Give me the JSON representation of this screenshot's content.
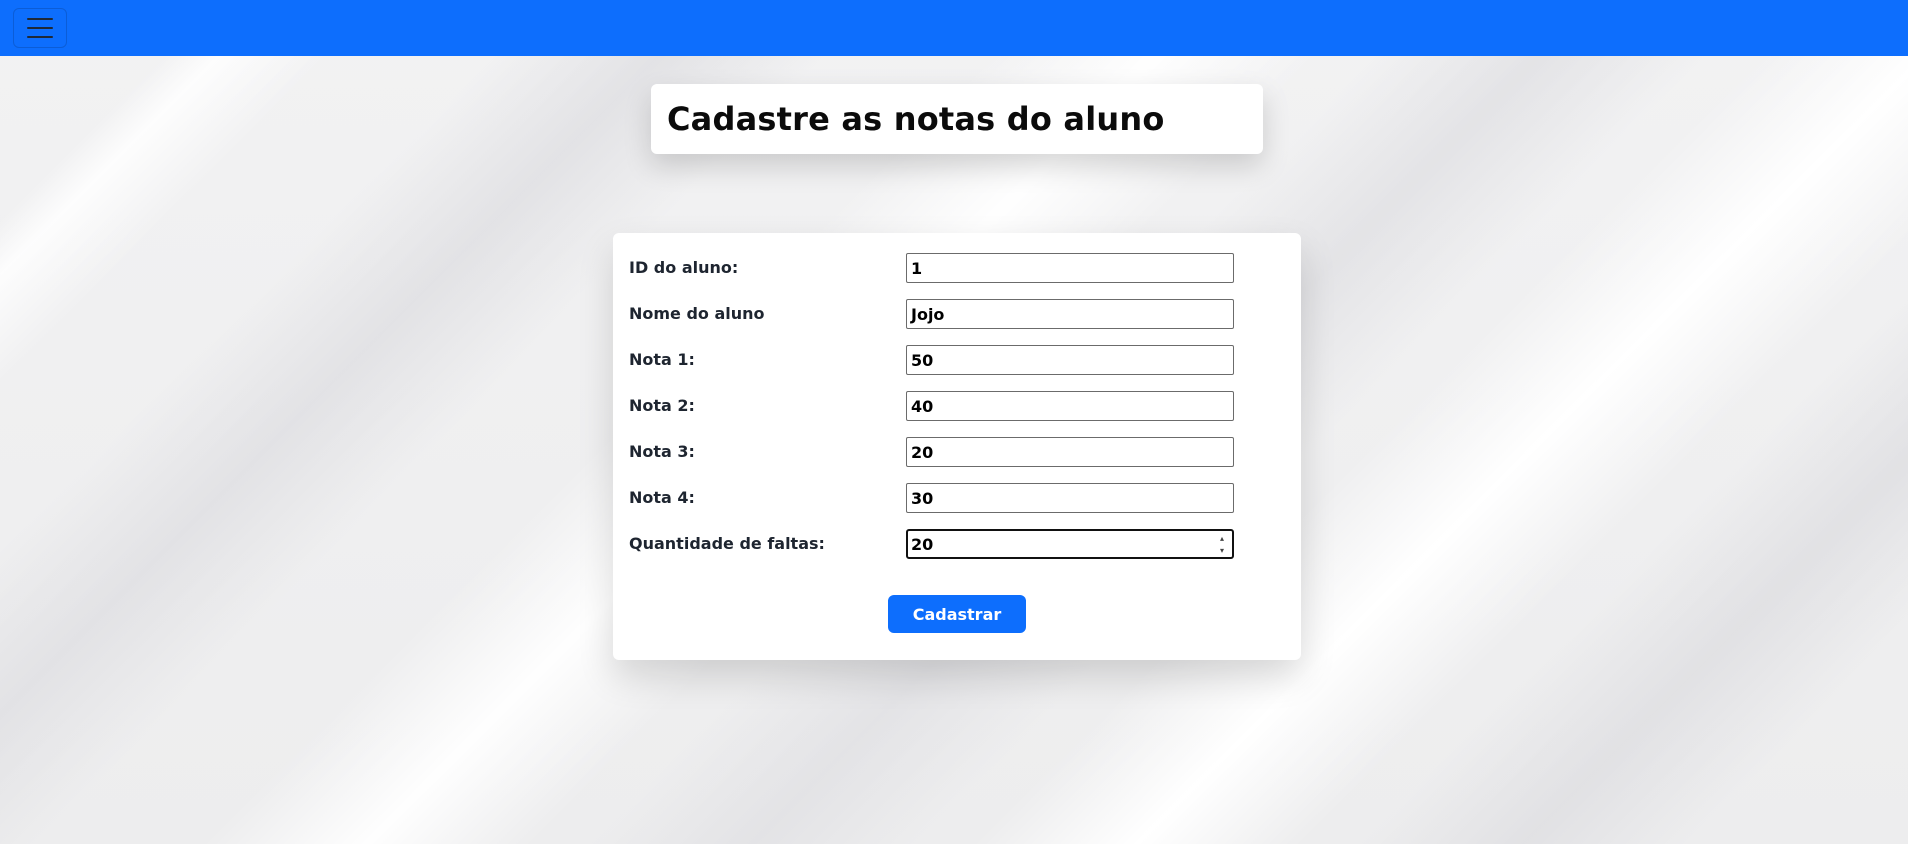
{
  "navbar": {
    "menu_icon": "hamburger-menu-icon",
    "color": "#0d6efd"
  },
  "title": "Cadastre as notas do aluno",
  "form": {
    "fields": [
      {
        "label": "ID do aluno:",
        "value": "1"
      },
      {
        "label": "Nome do aluno",
        "value": "Jojo"
      },
      {
        "label": "Nota 1:",
        "value": "50"
      },
      {
        "label": "Nota 2:",
        "value": "40"
      },
      {
        "label": "Nota 3:",
        "value": "20"
      },
      {
        "label": "Nota 4:",
        "value": "30"
      },
      {
        "label": "Quantidade de faltas:",
        "value": "20"
      }
    ],
    "submit_label": "Cadastrar"
  }
}
